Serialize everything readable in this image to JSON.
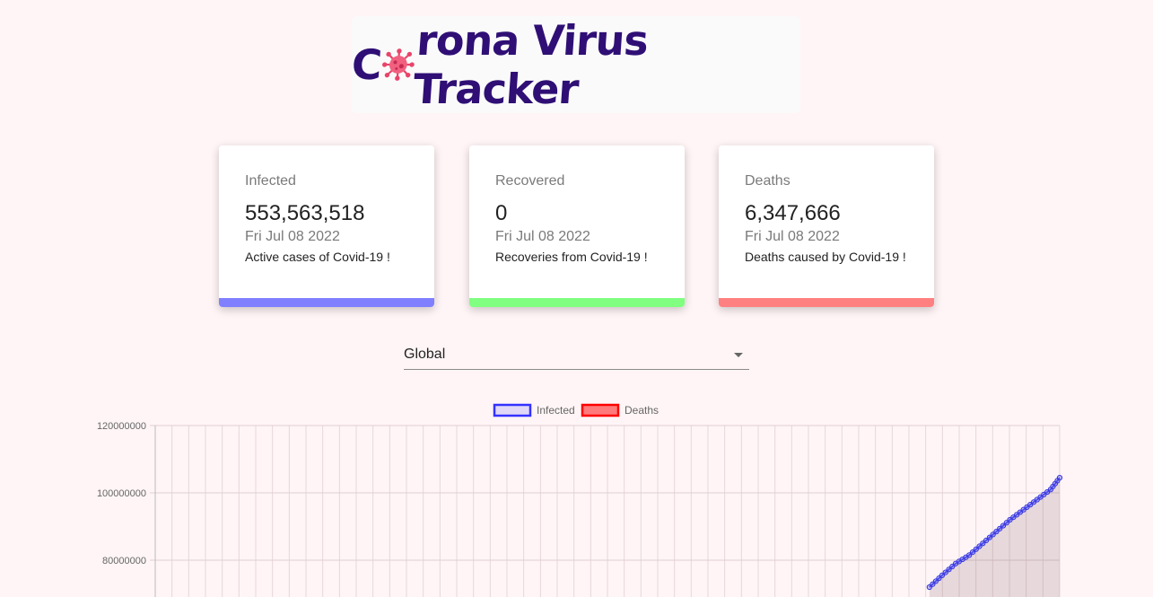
{
  "header": {
    "title_prefix": "C",
    "title_suffix": "rona Virus Tracker"
  },
  "cards": [
    {
      "label": "Infected",
      "value": "553,563,518",
      "date": "Fri Jul 08 2022",
      "description": "Active cases of Covid-19 !",
      "color": "#8080ff"
    },
    {
      "label": "Recovered",
      "value": "0",
      "date": "Fri Jul 08 2022",
      "description": "Recoveries from Covid-19 !",
      "color": "#80ff80"
    },
    {
      "label": "Deaths",
      "value": "6,347,666",
      "date": "Fri Jul 08 2022",
      "description": "Deaths caused by Covid-19 !",
      "color": "#ff8080"
    }
  ],
  "country_select": {
    "selected": "Global"
  },
  "chart_data": {
    "type": "line",
    "legend": [
      {
        "name": "Infected",
        "border": "#3333ff",
        "fill": "rgba(51,51,255,0.15)"
      },
      {
        "name": "Deaths",
        "border": "#ff0000",
        "fill": "rgba(255,0,0,0.5)"
      }
    ],
    "y_ticks": [
      "120000000",
      "100000000",
      "80000000"
    ],
    "ylim_visible": [
      75000000,
      120000000
    ],
    "series": [
      {
        "name": "Infected",
        "visible_points": [
          [
            0.856,
            72000000
          ],
          [
            0.87,
            75500000
          ],
          [
            0.885,
            79000000
          ],
          [
            0.9,
            81500000
          ],
          [
            0.915,
            85000000
          ],
          [
            0.93,
            88500000
          ],
          [
            0.945,
            92000000
          ],
          [
            0.96,
            95000000
          ],
          [
            0.975,
            98000000
          ],
          [
            0.99,
            101000000
          ],
          [
            1.0,
            104500000
          ]
        ]
      }
    ],
    "grid": true
  }
}
